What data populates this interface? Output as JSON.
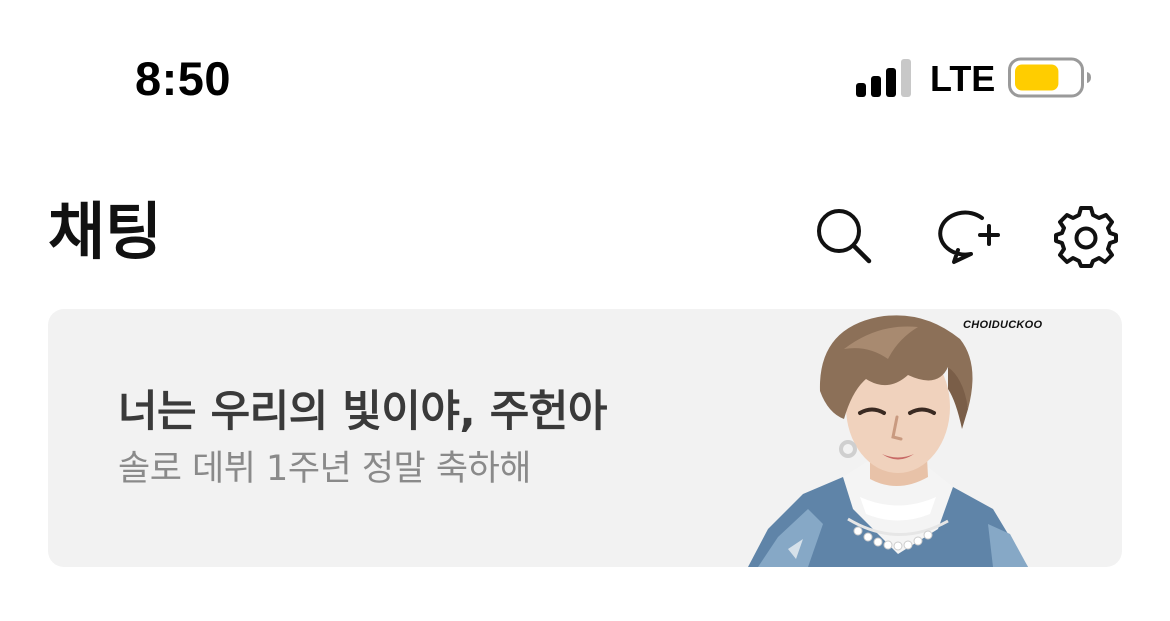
{
  "status_bar": {
    "time": "8:50",
    "network": "LTE",
    "signal_bars_active": 3,
    "signal_bars_total": 4,
    "battery_level": 0.7,
    "battery_color": "#FFCD00"
  },
  "header": {
    "title": "채팅",
    "icons": [
      "search-icon",
      "new-chat-icon",
      "settings-icon"
    ]
  },
  "banner": {
    "title": "너는 우리의 빛이야, 주헌아",
    "subtitle": "솔로 데뷔 1주년 정말 축하해",
    "image_watermark": "CHOIDUCKOO",
    "background_color": "#F2F2F2"
  }
}
